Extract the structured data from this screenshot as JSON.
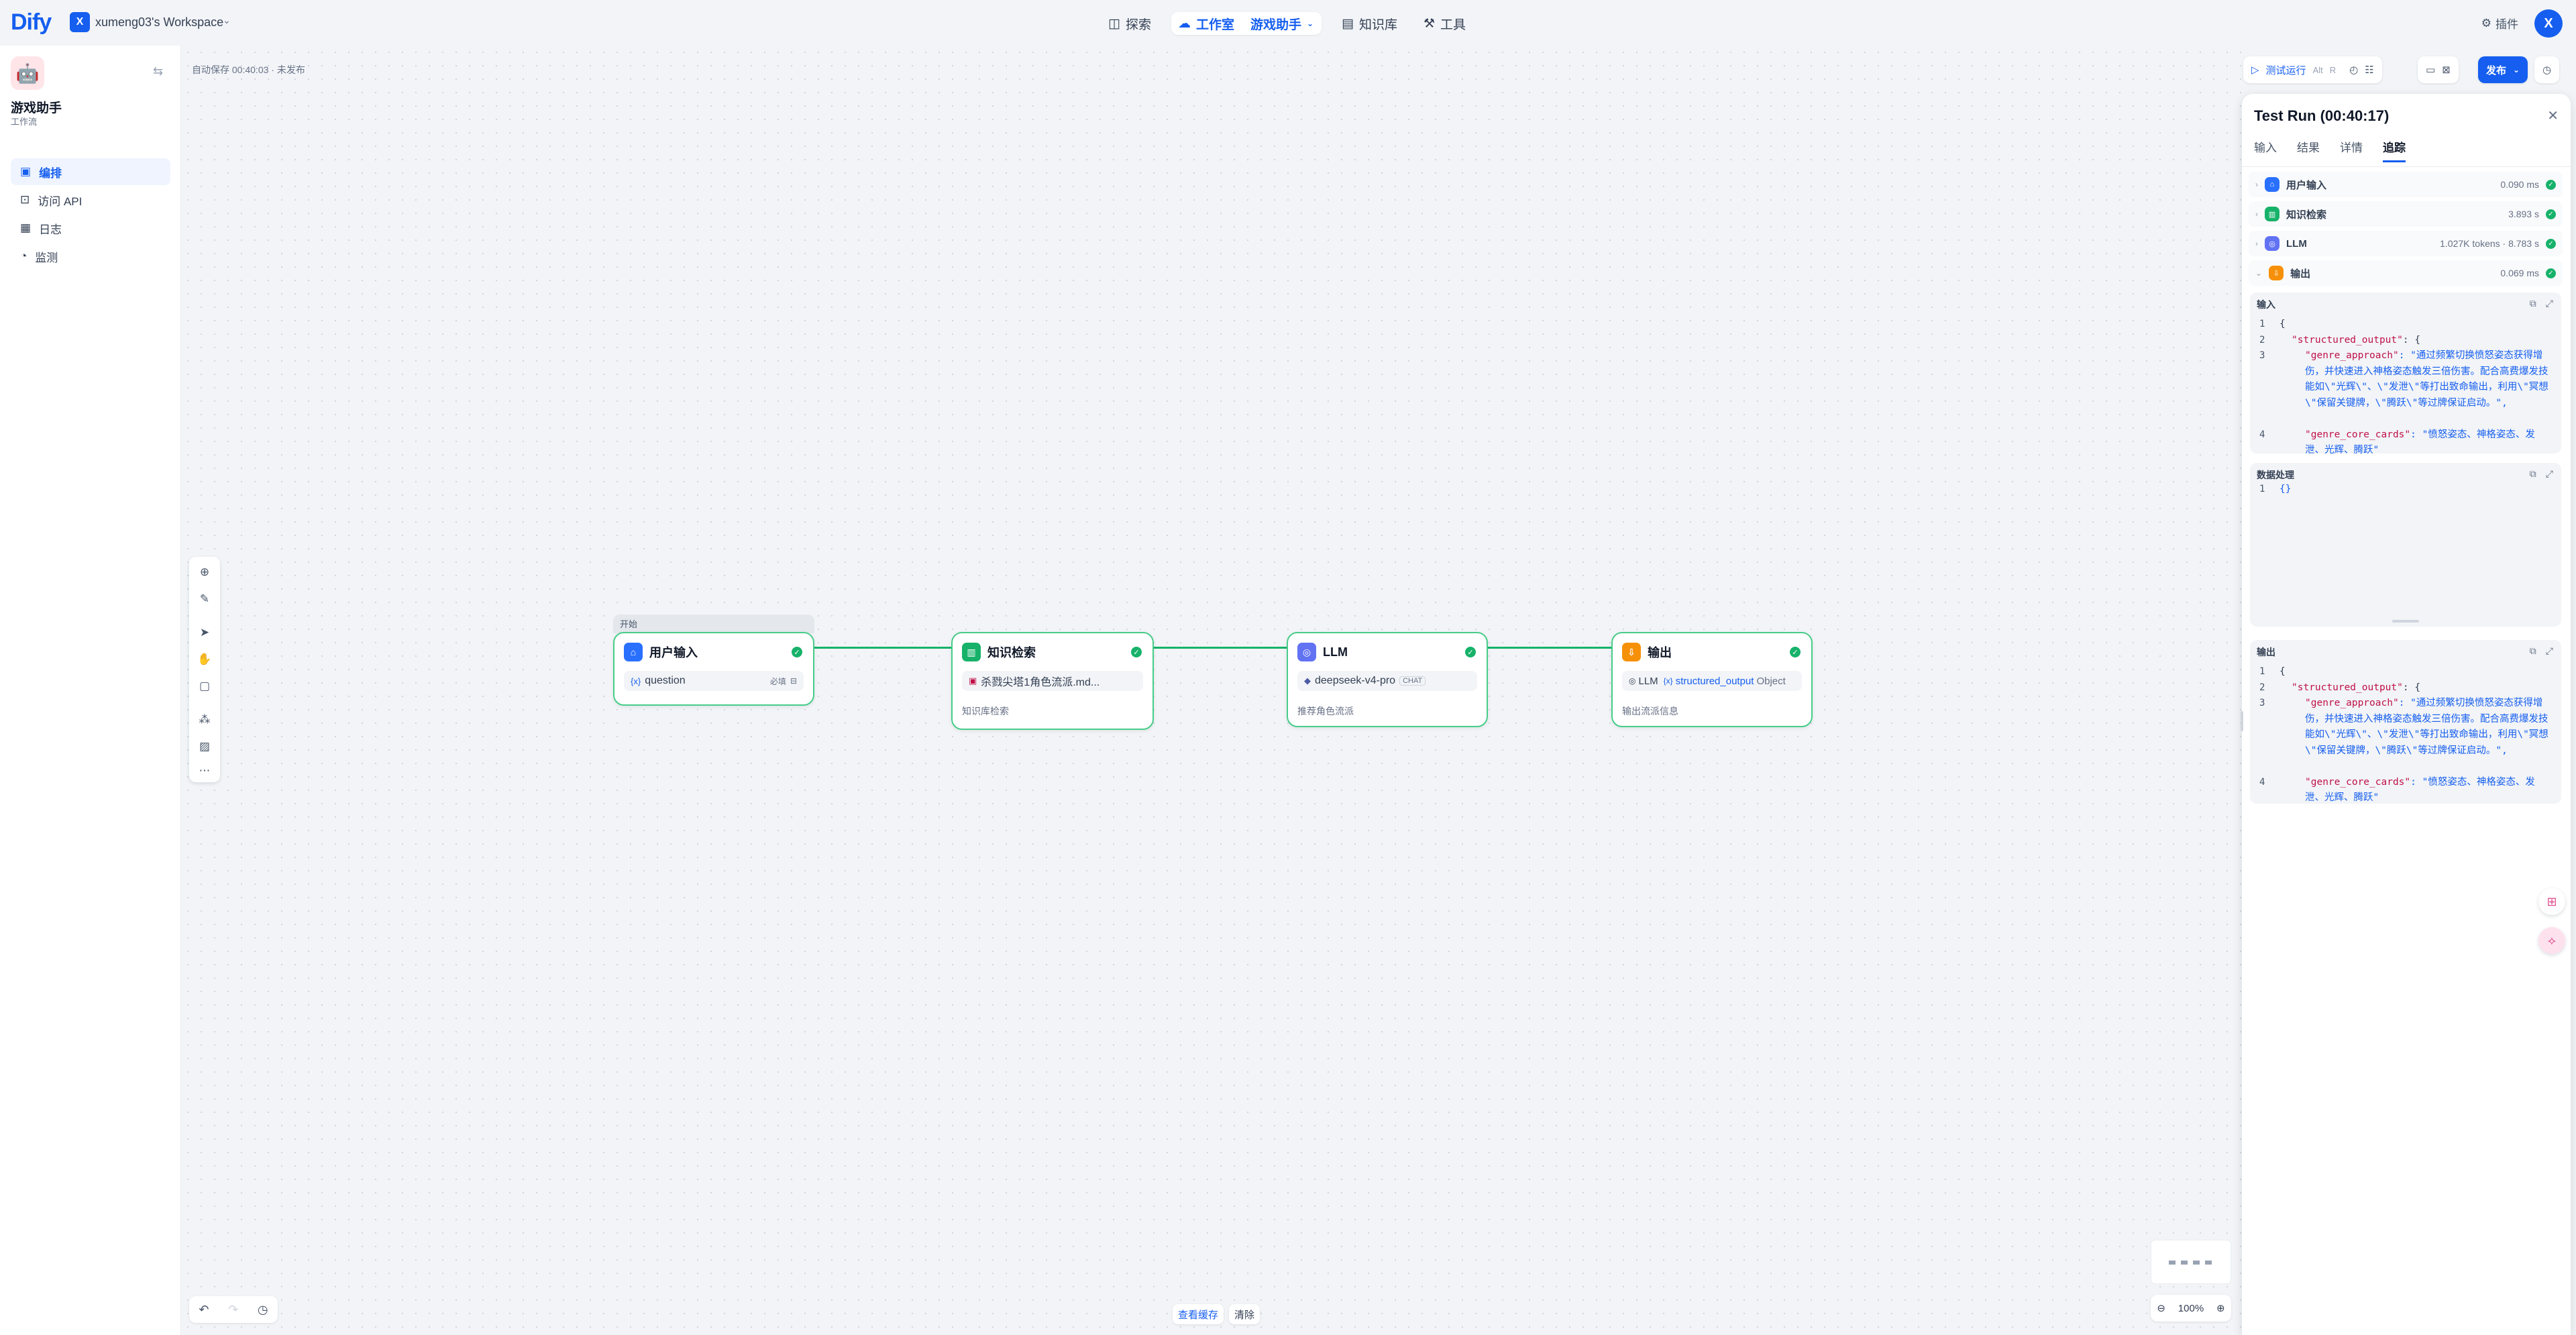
{
  "topbar": {
    "logo_text": "Dify",
    "workspace_initial": "X",
    "workspace_name": "xumeng03's Workspace",
    "nav": [
      {
        "label": "探索"
      },
      {
        "label": "工作室"
      },
      {
        "label": "游戏助手"
      },
      {
        "label": "知识库"
      },
      {
        "label": "工具"
      }
    ],
    "plugins_label": "插件",
    "user_initial": "X"
  },
  "sidebar": {
    "app_name": "游戏助手",
    "app_type": "工作流",
    "items": [
      {
        "label": "编排"
      },
      {
        "label": "访问 API"
      },
      {
        "label": "日志"
      },
      {
        "label": "监测"
      }
    ]
  },
  "canvas": {
    "autosave_text": "自动保存 00:40:03 · 未发布",
    "start_tag": "开始",
    "nodes": {
      "start": {
        "title": "用户输入",
        "var_icon": "{x}",
        "var_name": "question",
        "required": "必填"
      },
      "knowledge": {
        "title": "知识检索",
        "dataset": "杀戮尖塔1角色流派.md...",
        "desc": "知识库检索"
      },
      "llm": {
        "title": "LLM",
        "model": "deepseek-v4-pro",
        "mode": "CHAT",
        "desc": "推荐角色流派"
      },
      "output": {
        "title": "输出",
        "src_node": "LLM",
        "var_icon": "{x}",
        "var_name": "structured_output",
        "var_type": "Object",
        "desc": "输出流派信息"
      }
    },
    "view_cache": "查看缓存",
    "clear": "清除",
    "zoom_level": "100%"
  },
  "right_toolbar": {
    "test_run": "测试运行",
    "shortcut_1": "Alt",
    "shortcut_2": "R",
    "publish": "发布"
  },
  "panel": {
    "title": "Test Run (00:40:17)",
    "tabs": [
      "输入",
      "结果",
      "详情",
      "追踪"
    ],
    "traces": [
      {
        "name": "用户输入",
        "value": "0.090 ms",
        "color": "#2970ff"
      },
      {
        "name": "知识检索",
        "value": "3.893 s",
        "color": "#17b26a"
      },
      {
        "name": "LLM",
        "value": "1.027K tokens · 8.783 s",
        "color": "#6172f3"
      },
      {
        "name": "输出",
        "value": "0.069 ms",
        "color": "#f79009"
      }
    ],
    "input_block": {
      "title": "输入",
      "lines": [
        "1",
        "2",
        "3",
        "4"
      ],
      "open_brace": "{",
      "key1": "\"structured_output\"",
      "key1_tail": ": {",
      "key2": "\"genre_approach\"",
      "value2": ": \"通过频繁切换愤怒姿态获得增伤，并快速进入神格姿态触发三倍伤害。配合高费爆发技能如\\\"光辉\\\"、\\\"发泄\\\"等打出致命输出，利用\\\"冥想\\\"保留关键牌，\\\"腾跃\\\"等过牌保证启动。\",",
      "key3": "\"genre_core_cards\"",
      "value3": ": \"愤怒姿态、神格姿态、发泄、光辉、腾跃\""
    },
    "process_block": {
      "title": "数据处理",
      "line": "1",
      "content": "{}"
    },
    "output_block": {
      "title": "输出",
      "lines": [
        "1",
        "2",
        "3",
        "4"
      ],
      "open_brace": "{",
      "key1": "\"structured_output\"",
      "key1_tail": ": {",
      "key2": "\"genre_approach\"",
      "value2": ": \"通过频繁切换愤怒姿态获得增伤，并快速进入神格姿态触发三倍伤害。配合高费爆发技能如\\\"光辉\\\"、\\\"发泄\\\"等打出致命输出，利用\\\"冥想\\\"保留关键牌，\\\"腾跃\\\"等过牌保证启动。\",",
      "key3": "\"genre_core_cards\"",
      "value3": ": \"愤怒姿态、神格姿态、发泄、光辉、腾跃\""
    }
  }
}
